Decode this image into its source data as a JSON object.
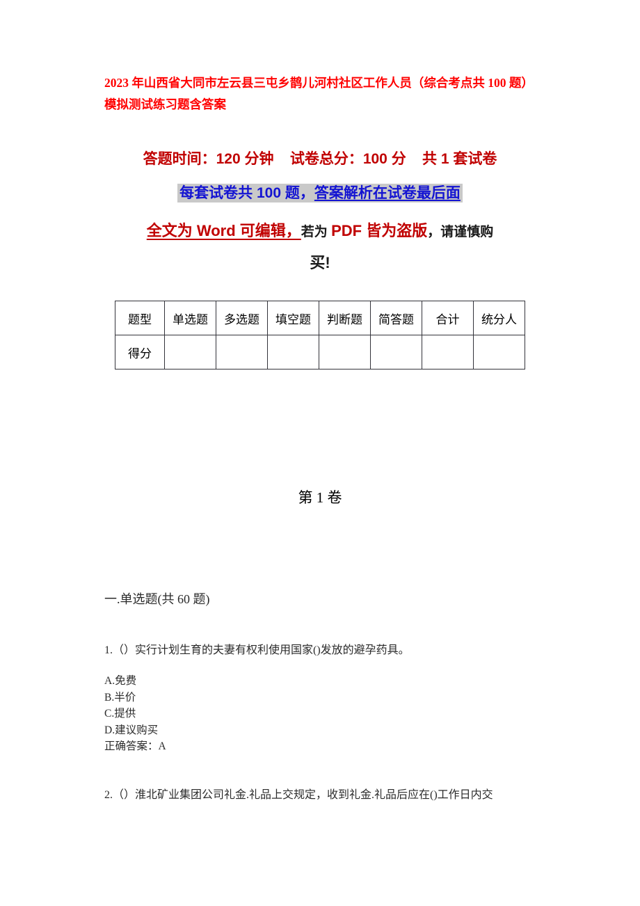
{
  "document": {
    "title": "2023 年山西省大同市左云县三屯乡鹊儿河村社区工作人员（综合考点共 100 题）模拟测试练习题含答案",
    "title_color": "#ff0000"
  },
  "banner": {
    "line1": "答题时间：120 分钟    试卷总分：100 分    共 1 套试卷",
    "line1_color": "#c00000",
    "line2_part1": "每套试卷共 100 题，",
    "line2_part2": "答案解析在试卷最后面",
    "line2_color": "#1414d2",
    "line2_highlight": "#c9c9c9",
    "line3_part1": "全文为 Word 可编辑，",
    "line3_part2": "若为 ",
    "line3_part3": "PDF 皆为盗版",
    "line3_part4": "，请谨慎购",
    "line4": "买!",
    "accent_red": "#c00000"
  },
  "score_table": {
    "headers": [
      "题型",
      "单选题",
      "多选题",
      "填空题",
      "判断题",
      "简答题",
      "合计",
      "统分人"
    ],
    "rows": [
      {
        "label": "得分",
        "cells": [
          "",
          "",
          "",
          "",
          "",
          "",
          ""
        ]
      }
    ]
  },
  "volume": {
    "label": "第 1 卷"
  },
  "section": {
    "heading": "一.单选题(共 60 题)"
  },
  "questions": [
    {
      "stem": "1.（）实行计划生育的夫妻有权利使用国家()发放的避孕药具。",
      "options": [
        "A.免费",
        "B.半价",
        "C.提供",
        "D.建议购买"
      ],
      "answer": "正确答案：A"
    },
    {
      "stem": "2.（）淮北矿业集团公司礼金.礼品上交规定，收到礼金.礼品后应在()工作日内交",
      "options": [],
      "answer": ""
    }
  ]
}
